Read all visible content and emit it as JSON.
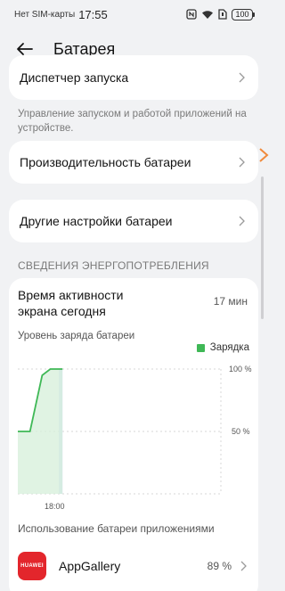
{
  "status_bar": {
    "carrier": "Нет SIM-карты",
    "time": "17:55",
    "battery_level": "100"
  },
  "header": {
    "title": "Батарея"
  },
  "settings": {
    "launch_manager": "Диспетчер запуска",
    "launch_note": "Управление запуском и работой приложений на устройстве.",
    "battery_performance": "Производительность батареи",
    "other_settings": "Другие настройки батареи"
  },
  "consumption": {
    "section_title": "СВЕДЕНИЯ ЭНЕРГОПОТРЕБЛЕНИЯ",
    "screen_active_label": "Время активности экрана сегодня",
    "screen_active_value": "17 мин",
    "level_label": "Уровень заряда батареи",
    "legend_charging": "Зарядка",
    "apps_title": "Использование батареи приложениями"
  },
  "chart_data": {
    "type": "area",
    "ylabels": [
      "100 %",
      "50 %"
    ],
    "ylim": [
      0,
      100
    ],
    "xlabel_tick": "18:00",
    "series": [
      {
        "name": "Зарядка",
        "points": [
          [
            0,
            50
          ],
          [
            0.06,
            50
          ],
          [
            0.12,
            95
          ],
          [
            0.16,
            100
          ],
          [
            0.22,
            100
          ]
        ]
      }
    ],
    "colors": {
      "line": "#3fb856",
      "fill": "#d8f0dc",
      "screen": "#c9d9f7"
    }
  },
  "apps": [
    {
      "icon_text": "HUAWEI",
      "name": "AppGallery",
      "percent": "89 %"
    }
  ]
}
